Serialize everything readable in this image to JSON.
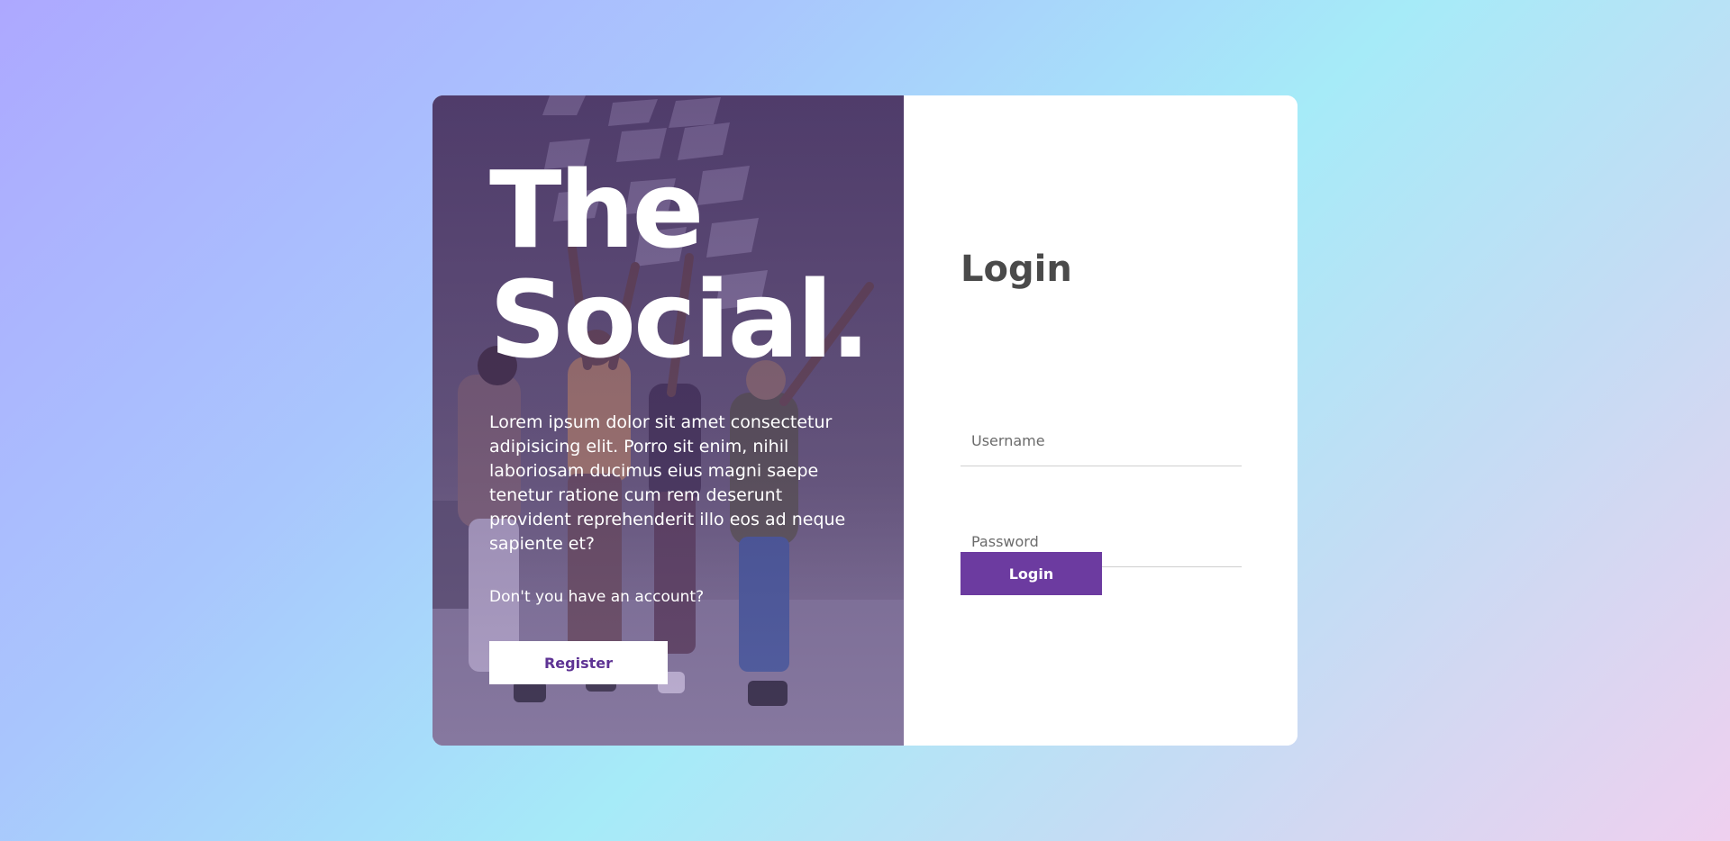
{
  "colors": {
    "accent": "#6c3ba0",
    "register_text": "#5e3394",
    "title_text": "#4a4a4a"
  },
  "hero": {
    "brand": "The Social.",
    "description": "Lorem ipsum dolor sit amet consectetur adipisicing elit. Porro sit enim, nihil laboriosam ducimus eius magni saepe tenetur ratione cum rem deserunt provident reprehenderit illo eos ad neque sapiente et?",
    "account_question": "Don't you have an account?",
    "register_label": "Register"
  },
  "login": {
    "title": "Login",
    "username_placeholder": "Username",
    "password_placeholder": "Password",
    "submit_label": "Login"
  }
}
